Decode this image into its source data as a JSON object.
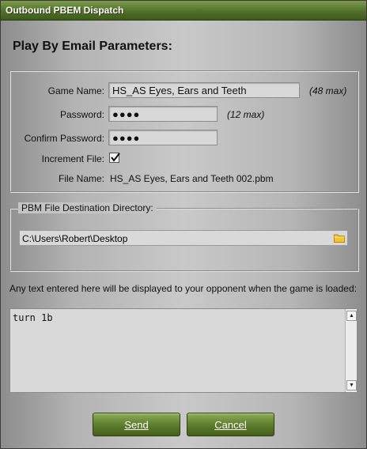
{
  "window": {
    "title": "Outbound PBEM Dispatch"
  },
  "heading": "Play By Email Parameters:",
  "form": {
    "game_name_label": "Game Name:",
    "game_name_value": "HS_AS Eyes, Ears and Teeth",
    "game_name_note": "(48 max)",
    "password_label": "Password:",
    "password_value": "●●●●",
    "password_note": "(12 max)",
    "confirm_label": "Confirm Password:",
    "confirm_value": "●●●●",
    "increment_label": "Increment File:",
    "increment_checked": true,
    "filename_label": "File Name:",
    "filename_value": "HS_AS Eyes, Ears and Teeth 002.pbm"
  },
  "destination": {
    "legend": "PBM File Destination Directory:",
    "path": "C:\\Users\\Robert\\Desktop",
    "icon": "folder-icon"
  },
  "message": {
    "hint": "Any text entered here will be displayed to your opponent when the game is loaded:",
    "text": "turn 1b"
  },
  "buttons": {
    "send_label": "Send",
    "cancel_label": "Cancel"
  },
  "colors": {
    "titlebar": "#53702a",
    "button": "#5f7e2e"
  }
}
